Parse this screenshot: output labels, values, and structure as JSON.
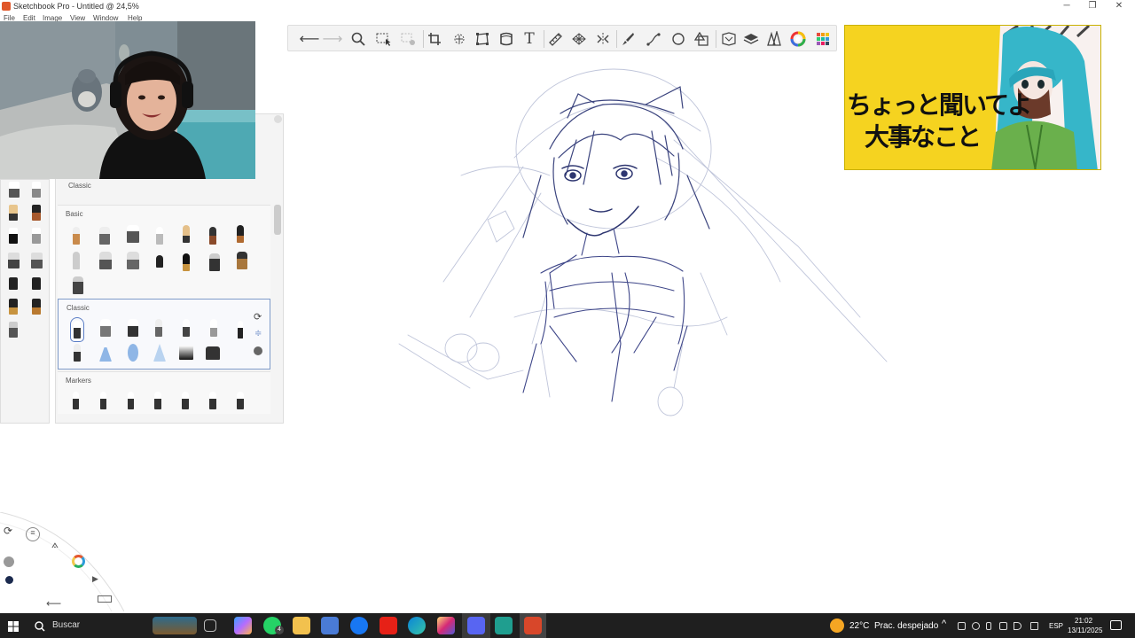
{
  "window": {
    "title": "Sketchbook Pro - Untitled @ 24,5%",
    "minimize_icon": "minimize-icon",
    "maximize_icon": "restore-icon",
    "close_icon": "close-icon"
  },
  "menu": {
    "items": [
      "File",
      "Edit",
      "Image",
      "View",
      "Window",
      "Help"
    ]
  },
  "toolbar": {
    "tools": [
      "undo-icon",
      "redo-icon",
      "zoom-icon",
      "select-icon",
      "lasso-select-icon",
      "crop-icon",
      "transform-icon",
      "distort-icon",
      "perspective-icon",
      "text-icon",
      "ruler-icon",
      "perspective-guide-icon",
      "symmetry-icon",
      "brush-icon",
      "stroke-icon",
      "ellipse-icon",
      "shape-icon",
      "copic-library-icon",
      "layers-icon",
      "brush-library-icon",
      "color-wheel-icon",
      "color-palette-icon"
    ]
  },
  "brush_library": {
    "header": "Classic",
    "sections": [
      {
        "label": "Basic"
      },
      {
        "label": "Classic"
      },
      {
        "label": "Markers"
      }
    ]
  },
  "reference": {
    "line1": "ちょっと聞いてよ",
    "line2": "大事なこと"
  },
  "taskbar": {
    "search_placeholder": "Buscar",
    "weather_temp": "22°C",
    "weather_desc": "Prac. despejado",
    "language": "ESP",
    "time": "21:02",
    "date": "13/11/2025",
    "whatsapp_badge": "4",
    "apps": [
      "windows-start-icon",
      "search-icon",
      "task-view-icon",
      "copilot-icon",
      "whatsapp-icon",
      "file-explorer-icon",
      "microsoft-store-icon",
      "facebook-icon",
      "youtube-icon",
      "edge-icon",
      "instagram-icon",
      "discord-icon",
      "app-icon",
      "sketchbook-icon"
    ]
  }
}
